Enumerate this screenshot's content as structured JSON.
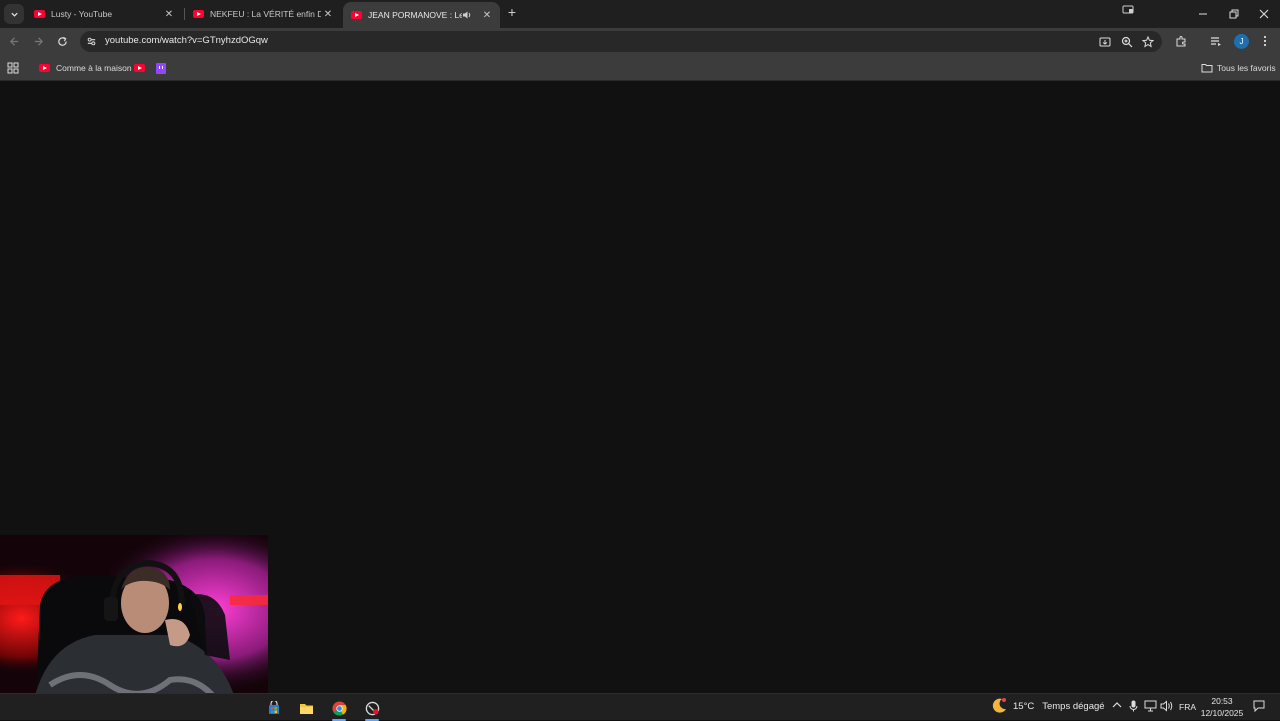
{
  "tabs": [
    {
      "title": "Lusty - YouTube",
      "close": "✕"
    },
    {
      "title": "NEKFEU : La VÉRITÉ enfin DÉVOILÉE",
      "close": "✕"
    },
    {
      "title": "JEAN PORMANOVE : Les ST",
      "close": "✕",
      "audio": true
    }
  ],
  "new_tab_label": "+",
  "address_bar": {
    "url": "youtube.com/watch?v=GTnyhzdOGqw"
  },
  "profile_initial": "J",
  "bookmarks": {
    "items": [
      {
        "label": "Comme à la maison",
        "icon": "youtube-icon"
      },
      {
        "label": "",
        "icon": "youtube-icon"
      },
      {
        "label": "",
        "icon": "twitch-icon"
      }
    ],
    "all_bookmarks_label": "Tous les favoris"
  },
  "taskbar": {
    "weather_temp": "15°C",
    "weather_desc": "Temps dégagé",
    "language": "FRA",
    "time": "20:53",
    "date": "12/10/2025"
  }
}
